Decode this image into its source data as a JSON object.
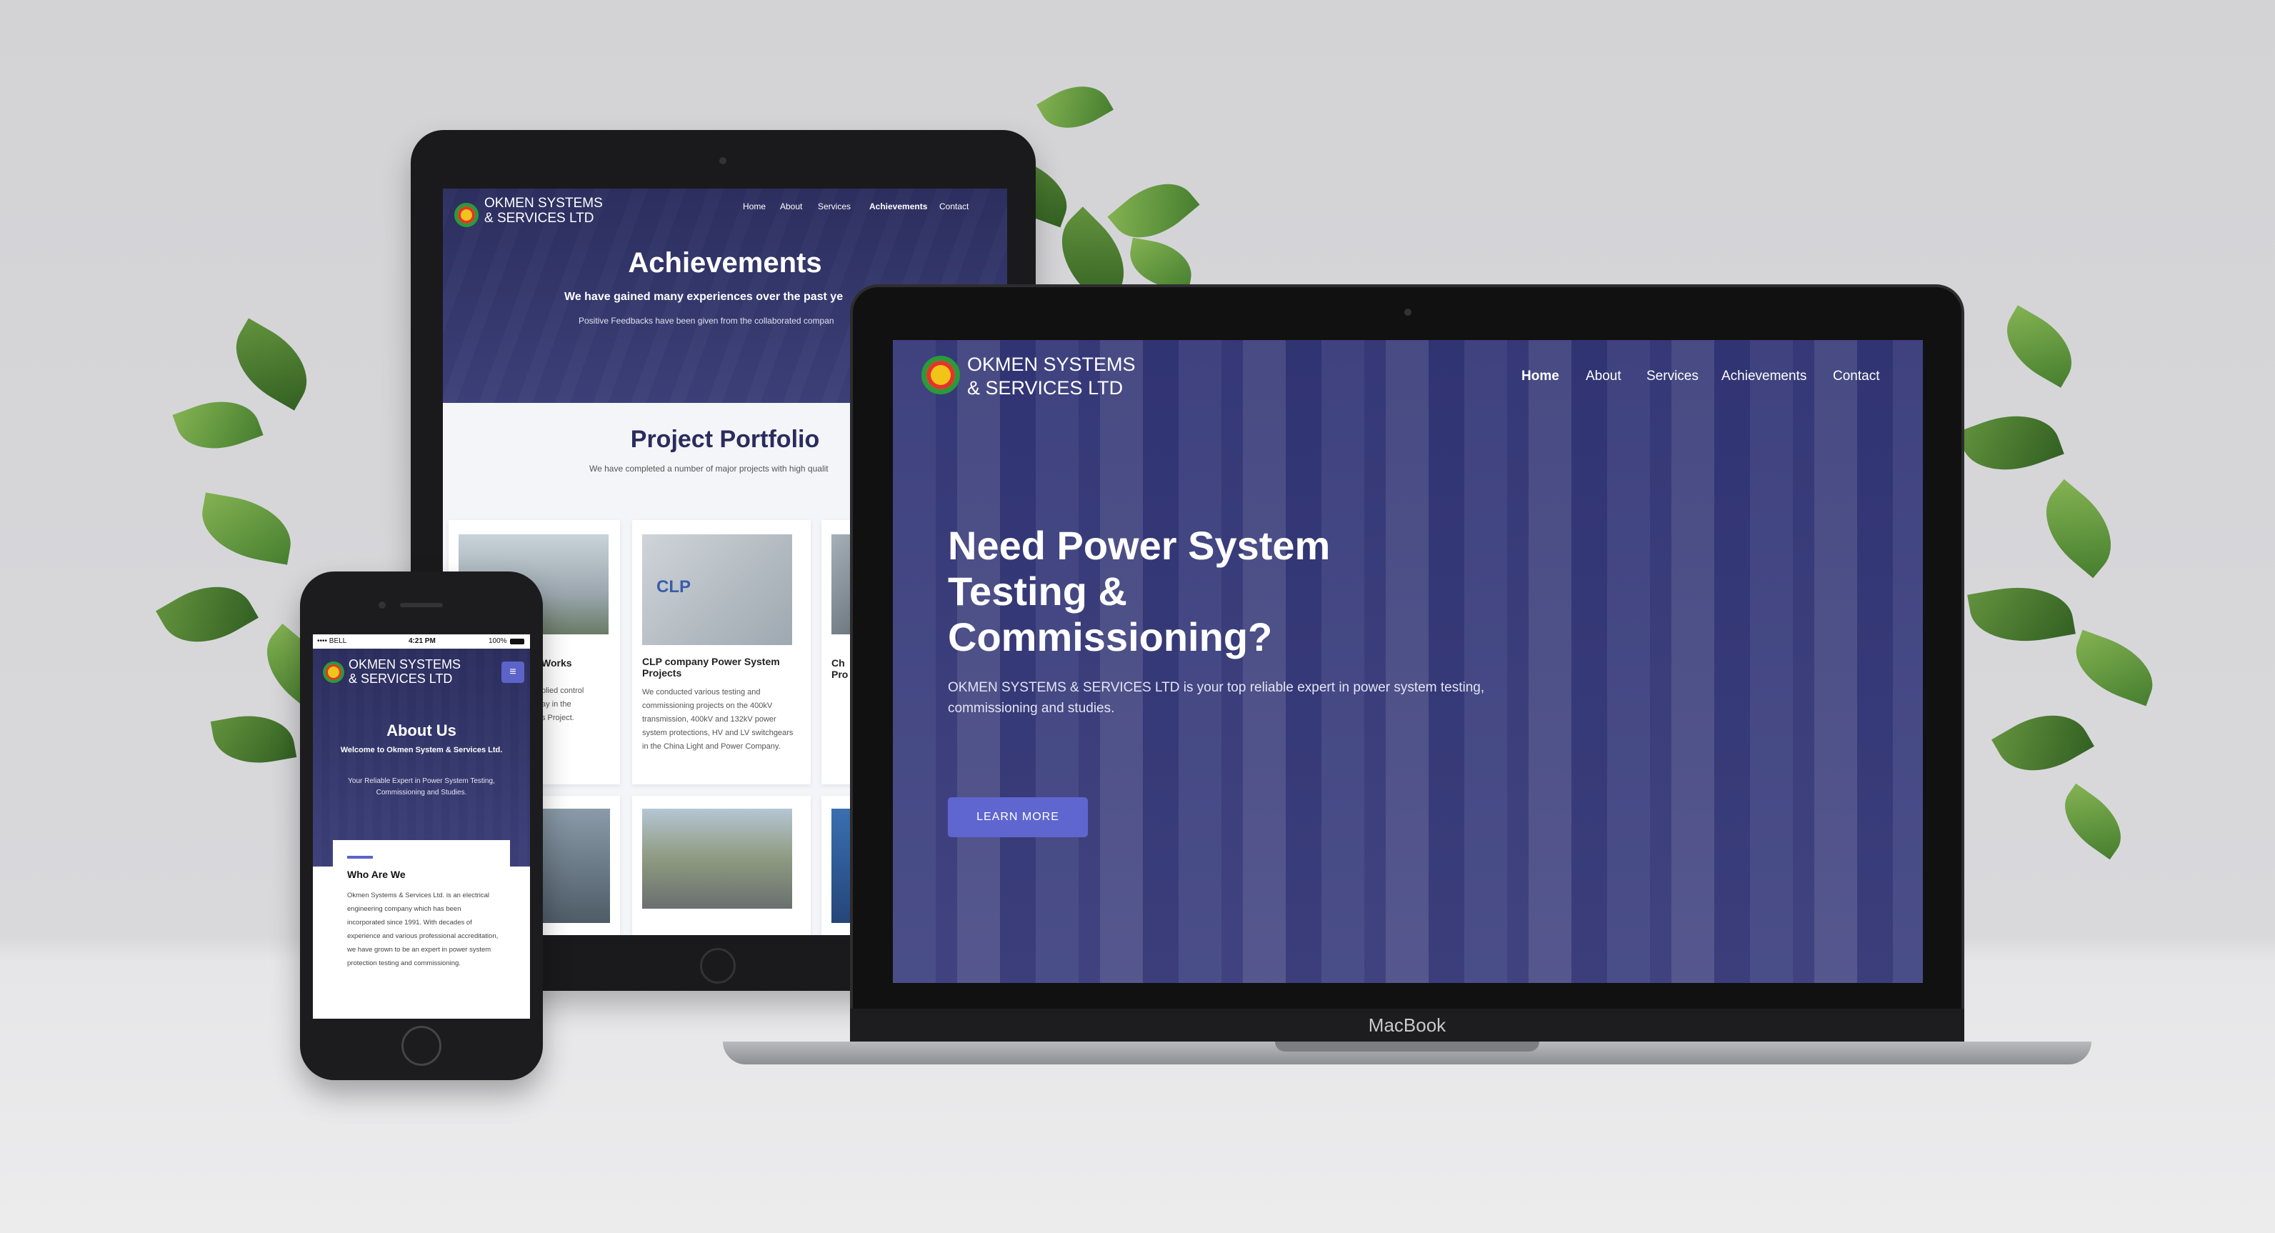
{
  "tablet": {
    "brand": [
      "OKMEN SYSTEMS",
      "& SERVICES LTD"
    ],
    "nav": [
      "Home",
      "About",
      "Services",
      "Achievements",
      "Contact"
    ],
    "heading": "Achievements",
    "subheading": "We have gained many experiences over the past ye",
    "text": "Positive Feedbacks have been given from the collaborated compan",
    "portfolio_title": "Project Portfolio",
    "portfolio_sub": "We have completed a number of major projects with high qualit",
    "cards": [
      {
        "title": "CLP company Power System Projects",
        "text": "We conducted various testing and commissioning projects on the 400kV transmission, 400kV and 132kV power system protections, HV and LV switchgears in the China Light and Power Company."
      }
    ],
    "partial_card_left": {
      "title": "Works",
      "text": [
        "plied control",
        "ay in the",
        "s Project."
      ]
    },
    "partial_card_right": {
      "title": [
        "Ch",
        "Pro"
      ]
    }
  },
  "phone": {
    "status": {
      "carrier": "•••• BELL",
      "time": "4:21 PM",
      "battery": "100%"
    },
    "brand": [
      "OKMEN SYSTEMS",
      "& SERVICES LTD"
    ],
    "menu_icon": "≡",
    "heading": "About Us",
    "subheading": "Welcome to Okmen System & Services Ltd.",
    "text": "Your Reliable Expert in Power System Testing, Commissioning and Studies.",
    "card_title": "Who Are We",
    "card_text": "Okmen Systems & Services Ltd. is an electrical engineering company which has been incorporated since 1991. With decades of experience and various professional accreditation, we have grown to be an expert in power system protection testing and commissioning."
  },
  "laptop": {
    "brand": [
      "OKMEN SYSTEMS",
      "& SERVICES LTD"
    ],
    "nav": [
      "Home",
      "About",
      "Services",
      "Achievements",
      "Contact"
    ],
    "headline": "Need Power System Testing & Commissioning?",
    "text": "OKMEN SYSTEMS & SERVICES LTD is your top reliable expert in power system testing, commissioning and studies.",
    "button": "LEARN MORE",
    "device_label": "MacBook"
  },
  "colors": {
    "accent": "#5f66cf",
    "hero_overlay": "#2a2c5c"
  }
}
